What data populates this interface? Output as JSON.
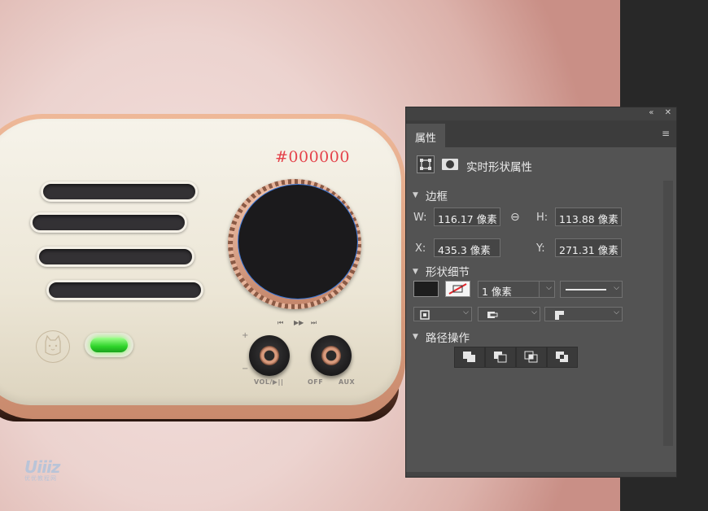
{
  "colors": {
    "accent_red": "#e4424a",
    "panel_bg": "#535353",
    "led_green": "#2ed42a",
    "dark_strip": "#282828"
  },
  "artwork": {
    "hex_label": "#000000",
    "transport_prev": "⏮",
    "transport_play": "▶▶",
    "transport_next": "⏭",
    "knob_plus": "+",
    "knob_minus": "−",
    "vol_label": "VOL/▶||",
    "off_label": "OFF",
    "aux_label": "AUX",
    "watermark_logo": "Uiiiz",
    "watermark_sub": "优优教程网"
  },
  "panel": {
    "collapse_icon": "«",
    "close_icon": "✕",
    "tab_label": "属性",
    "menu_icon": "≡",
    "header_title": "实时形状属性",
    "section_bounds": "边框",
    "w_label": "W:",
    "w_value": "116.17 像素",
    "h_label": "H:",
    "h_value": "113.88 像素",
    "link_icon": "⊖",
    "x_label": "X:",
    "x_value": "435.3 像素",
    "y_label": "Y:",
    "y_value": "271.31 像素",
    "section_shape": "形状细节",
    "stroke_width": "1 像素",
    "section_path": "路径操作"
  }
}
